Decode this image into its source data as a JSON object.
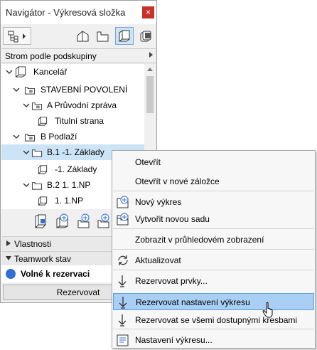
{
  "window": {
    "title": "Navigátor - Výkresová složka",
    "close": "×"
  },
  "view_selector": {
    "label": "Strom podle podskupiny"
  },
  "tree": [
    {
      "label": "Kancelář",
      "indent": 0,
      "expanded": true,
      "selected": false
    },
    {
      "label": "STAVEBNÍ POVOLENÍ",
      "indent": 1,
      "expanded": true,
      "selected": false
    },
    {
      "label": "A Průvodní zpráva",
      "indent": 2,
      "expanded": true,
      "selected": false
    },
    {
      "label": "Titulní strana",
      "indent": 3,
      "expanded": false,
      "selected": false
    },
    {
      "label": "B Podlaží",
      "indent": 1,
      "expanded": true,
      "selected": false
    },
    {
      "label": "B.1 -1. Základy",
      "indent": 2,
      "expanded": true,
      "selected": true
    },
    {
      "label": "-1. Základy",
      "indent": 3,
      "expanded": false,
      "selected": false
    },
    {
      "label": "B.2 1. 1.NP",
      "indent": 2,
      "expanded": true,
      "selected": false
    },
    {
      "label": "1. 1.NP",
      "indent": 3,
      "expanded": false,
      "selected": false
    }
  ],
  "sections": {
    "properties": "Vlastnosti",
    "teamwork": "Teamwork stav"
  },
  "status": {
    "label": "Volné k rezervaci",
    "color": "#2f6fd6"
  },
  "reserve_button": "Rezervovat",
  "context_menu": [
    {
      "label": "Otevřít",
      "icon": "",
      "highlight": false
    },
    {
      "label": "Otevřít v nové záložce",
      "icon": "",
      "highlight": false
    },
    {
      "label": "Nový výkres",
      "icon": "new-drawing-icon",
      "highlight": false
    },
    {
      "label": "Vytvořit novou sadu",
      "icon": "new-set-icon",
      "highlight": false
    },
    {
      "label": "Zobrazit v průhledovém zobrazení",
      "icon": "",
      "highlight": false
    },
    {
      "label": "Aktualizovat",
      "icon": "refresh-icon",
      "highlight": false
    },
    {
      "label": "Rezervovat prvky...",
      "icon": "reserve-arrow-icon",
      "highlight": false
    },
    {
      "label": "Rezervovat nastavení výkresu",
      "icon": "reserve-arrow-icon",
      "highlight": true
    },
    {
      "label": "Rezervovat se všemi dostupnými kresbami",
      "icon": "reserve-arrow-icon",
      "highlight": false
    },
    {
      "label": "Nastavení výkresu...",
      "icon": "drawing-settings-icon",
      "highlight": false
    }
  ],
  "colors": {
    "selection": "#cce4f7",
    "menu_highlight": "#a9cff5",
    "close": "#c9302c"
  }
}
